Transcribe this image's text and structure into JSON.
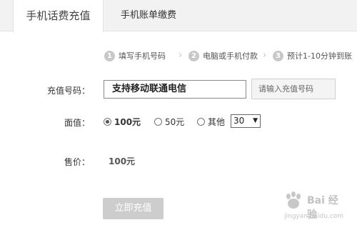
{
  "tabs": [
    {
      "label": "手机话费充值",
      "active": true
    },
    {
      "label": "手机账单缴费",
      "active": false
    }
  ],
  "steps": [
    {
      "num": "1",
      "label": "填写手机号码"
    },
    {
      "num": "2",
      "label": "电脑或手机付款"
    },
    {
      "num": "3",
      "label": "预计1-10分钟到账"
    }
  ],
  "form": {
    "phone_label": "充值号码：",
    "phone_value": "支持移动联通电信",
    "phone_placeholder": "请输入充值号码",
    "amount_label": "面值：",
    "amount_options": [
      {
        "label": "100元",
        "checked": true
      },
      {
        "label": "50元",
        "checked": false
      },
      {
        "label": "其他",
        "checked": false
      }
    ],
    "other_select_value": "30",
    "price_label": "售价：",
    "price_value": "100元",
    "submit_label": "立即充值"
  },
  "watermark": {
    "text": "Bai 经验",
    "url": "jingyan.baidu.com"
  }
}
